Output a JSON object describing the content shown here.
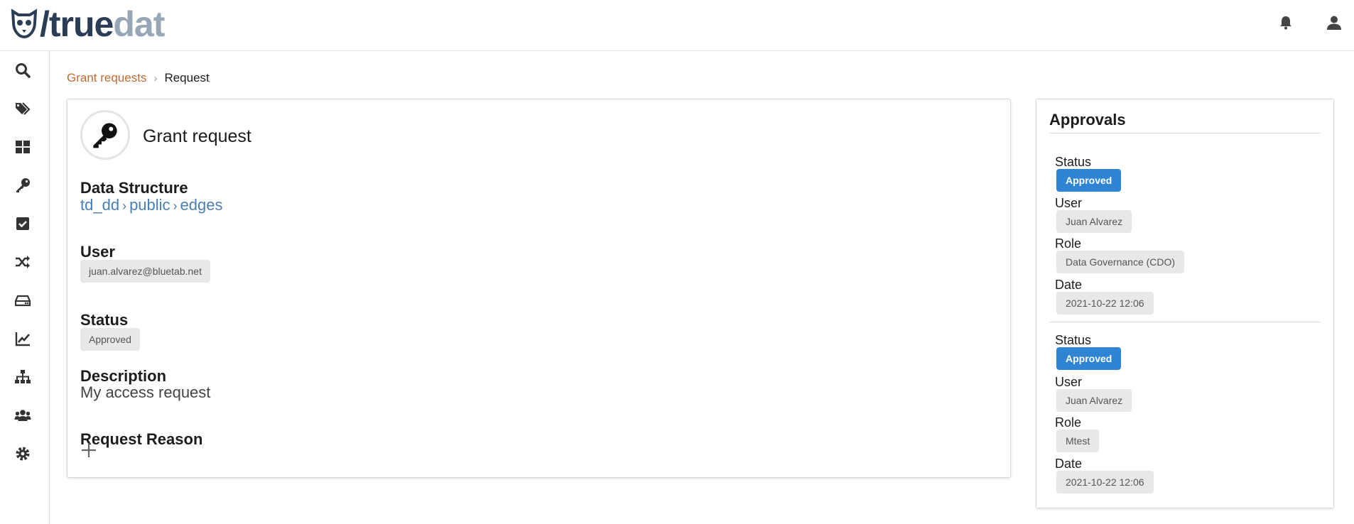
{
  "header": {
    "logo": {
      "slash": "/",
      "part1": "true",
      "part2": "dat"
    },
    "icons": [
      "bell-icon",
      "user-icon"
    ]
  },
  "sidebar": {
    "items": [
      {
        "icon": "search-icon"
      },
      {
        "icon": "tags-icon"
      },
      {
        "icon": "dashboard-icon"
      },
      {
        "icon": "key-icon"
      },
      {
        "icon": "check-square-icon"
      },
      {
        "icon": "shuffle-icon"
      },
      {
        "icon": "hard-drive-icon"
      },
      {
        "icon": "chart-line-icon"
      },
      {
        "icon": "sitemap-icon"
      },
      {
        "icon": "users-icon"
      },
      {
        "icon": "gear-icon"
      }
    ]
  },
  "breadcrumb": {
    "link": "Grant requests",
    "separator": "›",
    "current": "Request"
  },
  "request": {
    "title": "Grant request",
    "icon": "key-icon",
    "data_structure_label": "Data Structure",
    "path": [
      "td_dd",
      "public",
      "edges"
    ],
    "path_sep": "›",
    "user_label": "User",
    "user_value": "juan.alvarez@bluetab.net",
    "status_label": "Status",
    "status_value": "Approved",
    "description_label": "Description",
    "description_value": "My access request",
    "reason_label": "Request Reason",
    "reason_icon": "plus-icon"
  },
  "approvals": {
    "title": "Approvals",
    "items": [
      {
        "status_label": "Status",
        "status": "Approved",
        "user_label": "User",
        "user": "Juan Alvarez",
        "role_label": "Role",
        "role": "Data Governance (CDO)",
        "date_label": "Date",
        "date": "2021-10-22 12:06"
      },
      {
        "status_label": "Status",
        "status": "Approved",
        "user_label": "User",
        "user": "Juan Alvarez",
        "role_label": "Role",
        "role": "Mtest",
        "date_label": "Date",
        "date": "2021-10-22 12:06"
      }
    ]
  },
  "colors": {
    "link": "#c06a36",
    "path": "#4a7fb5",
    "badge": "#2f84d4",
    "chip": "#e8e8e8",
    "logo_dark": "#2a3d55",
    "logo_light": "#97a7b6"
  }
}
